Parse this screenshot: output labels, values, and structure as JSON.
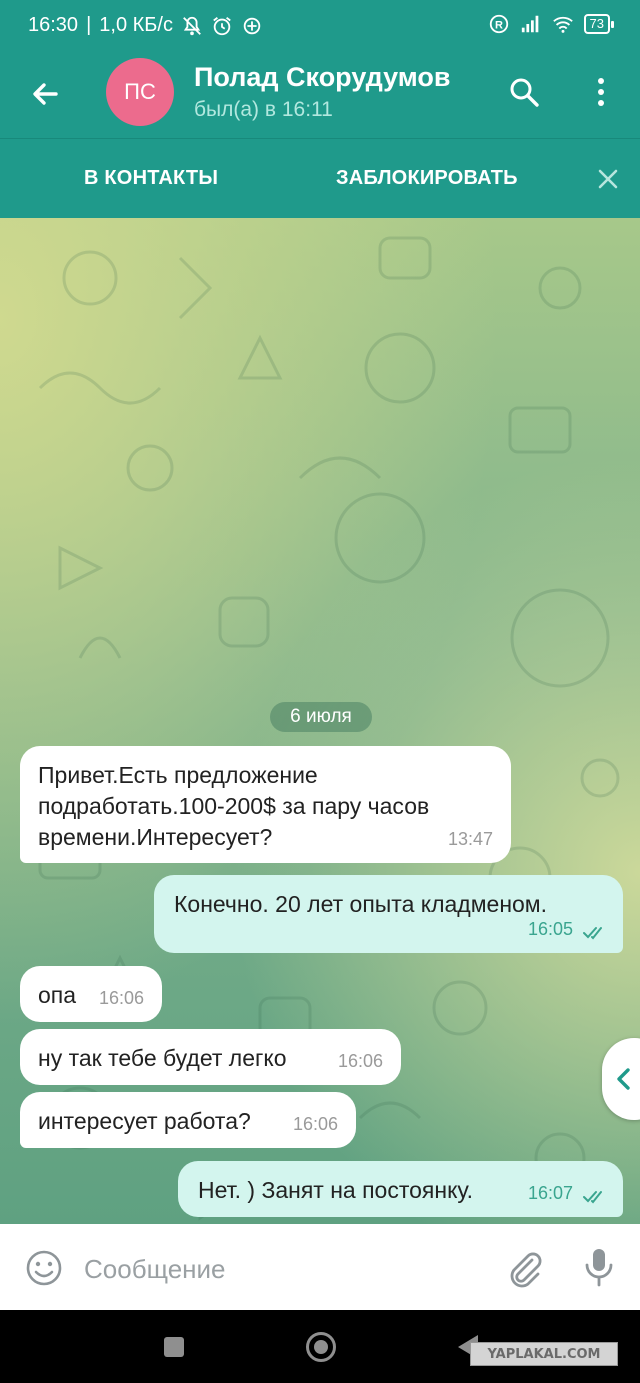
{
  "status_bar": {
    "time": "16:30",
    "speed": "1,0 КБ/с",
    "battery": "73",
    "icons": [
      "mute-icon",
      "alarm-icon",
      "location-icon",
      "roaming-icon",
      "signal-icon",
      "wifi-icon",
      "battery-icon"
    ]
  },
  "header": {
    "avatar_initials": "ПС",
    "avatar_color": "#ec6b8d",
    "name": "Полад Скорудумов",
    "last_seen": "был(а) в 16:11"
  },
  "action_bar": {
    "add_contact": "В КОНТАКТЫ",
    "block": "ЗАБЛОКИРОВАТЬ"
  },
  "chat": {
    "date": "6 июля",
    "messages": [
      {
        "direction": "in",
        "text": "Привет.Есть предложение подработать.100-200$ за пару часов времени.Интересует?",
        "time": "13:47"
      },
      {
        "direction": "out",
        "text": "Конечно. 20 лет опыта кладменом.",
        "time": "16:05",
        "read": true
      },
      {
        "direction": "in",
        "text": "опа",
        "time": "16:06"
      },
      {
        "direction": "in",
        "text": "ну так тебе будет легко",
        "time": "16:06"
      },
      {
        "direction": "in",
        "text": "интересует работа?",
        "time": "16:06"
      },
      {
        "direction": "out",
        "text": "Нет. ) Занят на постоянку.",
        "time": "16:07",
        "read": true
      }
    ]
  },
  "input": {
    "placeholder": "Сообщение"
  },
  "watermark": "YAPLAKAL.COM",
  "colors": {
    "accent": "#1f9a8b",
    "outgoing_bubble": "#d3f5ee",
    "incoming_bubble": "#ffffff"
  }
}
